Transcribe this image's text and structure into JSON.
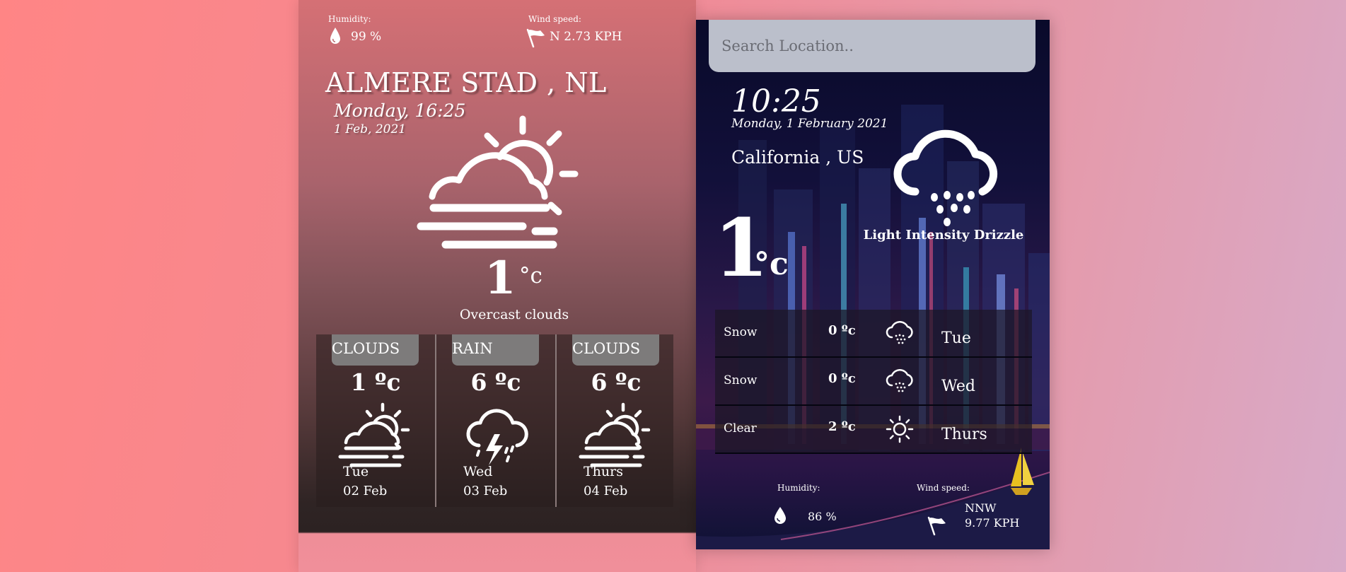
{
  "left_card": {
    "humidity_label": "Humidity:",
    "humidity_value": "99 %",
    "wind_label": "Wind speed:",
    "wind_value": "N 2.73 KPH",
    "city": "ALMERE STAD , NL",
    "day_time": "Monday, 16:25",
    "date": "1 Feb, 2021",
    "main_icon": "partly-cloudy-fog-icon",
    "temperature": "1",
    "unit": "°c",
    "description": "Overcast clouds",
    "forecast": [
      {
        "tag": "CLOUDS",
        "temp": "1 ºc",
        "icon": "partly-cloudy-fog-icon",
        "day": "Tue",
        "date": "02 Feb"
      },
      {
        "tag": "RAIN",
        "temp": "6 ºc",
        "icon": "thunderstorm-icon",
        "day": "Wed",
        "date": "03 Feb"
      },
      {
        "tag": "CLOUDS",
        "temp": "6 ºc",
        "icon": "partly-cloudy-fog-icon",
        "day": "Thurs",
        "date": "04 Feb"
      }
    ]
  },
  "right_card": {
    "search_placeholder": "Search Location..",
    "time": "10:25",
    "date": "Monday, 1 February 2021",
    "city": "California , US",
    "main_icon": "drizzle-icon",
    "description": "Light Intensity Drizzle",
    "temperature": "1",
    "unit": "°c",
    "forecast": [
      {
        "desc": "Snow",
        "temp": "0 ºc",
        "icon": "snow-cloud-icon",
        "day": "Tue"
      },
      {
        "desc": "Snow",
        "temp": "0 ºc",
        "icon": "snow-cloud-icon",
        "day": "Wed"
      },
      {
        "desc": "Clear",
        "temp": "2 ºc",
        "icon": "sun-icon",
        "day": "Thurs"
      }
    ],
    "humidity_label": "Humidity:",
    "humidity_value": "86 %",
    "wind_label": "Wind speed:",
    "wind_direction": "NNW",
    "wind_speed": "9.77 KPH"
  }
}
